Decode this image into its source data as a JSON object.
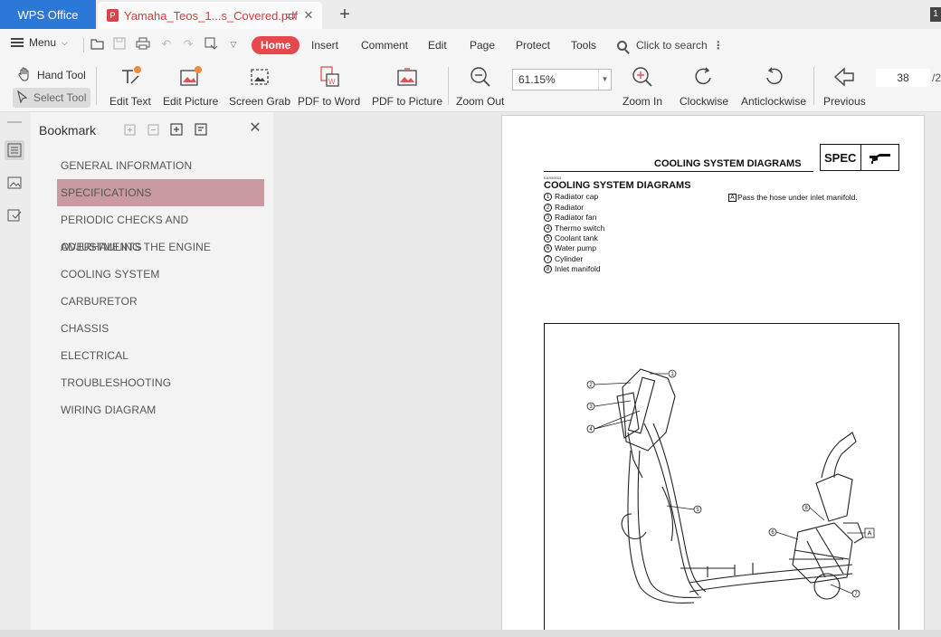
{
  "titlebar": {
    "app_name": "WPS Office",
    "doc_tab_title": "Yamaha_Teos_1...s_Covered.pdf",
    "corner_badge": "1"
  },
  "menubar": {
    "menu_label": "Menu",
    "tabs": [
      "Home",
      "Insert",
      "Comment",
      "Edit",
      "Page",
      "Protect",
      "Tools"
    ],
    "active_tab": "Home",
    "search_label": "Click to search"
  },
  "toolbar": {
    "hand_tool": "Hand Tool",
    "select_tool": "Select Tool",
    "edit_text": "Edit Text",
    "edit_picture": "Edit Picture",
    "screen_grab": "Screen Grab",
    "pdf_to_word": "PDF to Word",
    "pdf_to_picture": "PDF to Picture",
    "zoom_out": "Zoom Out",
    "zoom_value": "61.15%",
    "zoom_in": "Zoom In",
    "clockwise": "Clockwise",
    "anticlockwise": "Anticlockwise",
    "previous": "Previous",
    "current_page": "38",
    "page_total": "/2"
  },
  "bookmark": {
    "title": "Bookmark",
    "items": [
      "GENERAL INFORMATION",
      "SPECIFICATIONS",
      "PERIODIC CHECKS AND ADJUSTMENTS",
      "OVERHAULING THE ENGINE",
      "COOLING SYSTEM",
      "CARBURETOR",
      "CHASSIS",
      "ELECTRICAL",
      "TROUBLESHOOTING",
      "WIRING DIAGRAM"
    ],
    "selected_index": 1
  },
  "page": {
    "header": "COOLING SYSTEM DIAGRAMS",
    "spec_label": "SPEC",
    "code": "EAS00033",
    "section_title": "COOLING SYSTEM DIAGRAMS",
    "parts": [
      {
        "num": "1",
        "name": "Radiator cap"
      },
      {
        "num": "2",
        "name": "Radiator"
      },
      {
        "num": "3",
        "name": "Radiator fan"
      },
      {
        "num": "4",
        "name": "Thermo switch"
      },
      {
        "num": "5",
        "name": "Coolant tank"
      },
      {
        "num": "6",
        "name": "Water pump"
      },
      {
        "num": "7",
        "name": "Cylinder"
      },
      {
        "num": "8",
        "name": "Inlet manifold"
      }
    ],
    "note_letter": "A",
    "note_text": "Pass the hose under inlet manifold.",
    "callouts": [
      "1",
      "2",
      "3",
      "4",
      "5",
      "6",
      "7",
      "8",
      "A"
    ]
  }
}
